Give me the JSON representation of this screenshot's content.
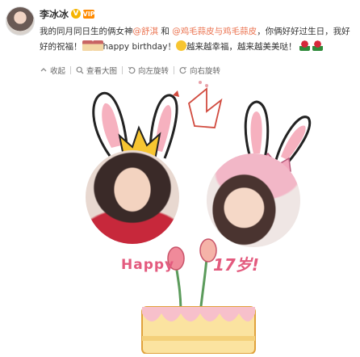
{
  "post": {
    "username": "李冰冰",
    "badge_v": "V",
    "badge_vip": "VIP",
    "text": {
      "part1": "我的同月同日生的俩女神",
      "mention1": "@舒淇",
      "part2": " 和 ",
      "mention2": "@鸡毛蒜皮与鸡毛蒜皮",
      "part3": "，你俩好好过生日，我好好的祝福！",
      "part4": "happy birthday！",
      "part5": "越来越幸福，越来越美美哒！"
    },
    "toolbar": {
      "collapse": "收起",
      "view_large": "查看大图",
      "rotate_left": "向左旋转",
      "rotate_right": "向右旋转"
    }
  },
  "image": {
    "happy": "Happy",
    "age": "17岁!"
  },
  "icons": [
    "avatar",
    "v-badge-icon",
    "vip-badge-icon",
    "cake-emoji-icon",
    "smile-emoji-icon",
    "rose-emoji-icon",
    "collapse-icon",
    "zoom-icon",
    "rotate-left-icon",
    "rotate-right-icon"
  ],
  "colors": {
    "mention": "#eb7350",
    "badge_v": "#f5b400",
    "happy_text": "#e35a7e",
    "crown": "#f7c531"
  }
}
